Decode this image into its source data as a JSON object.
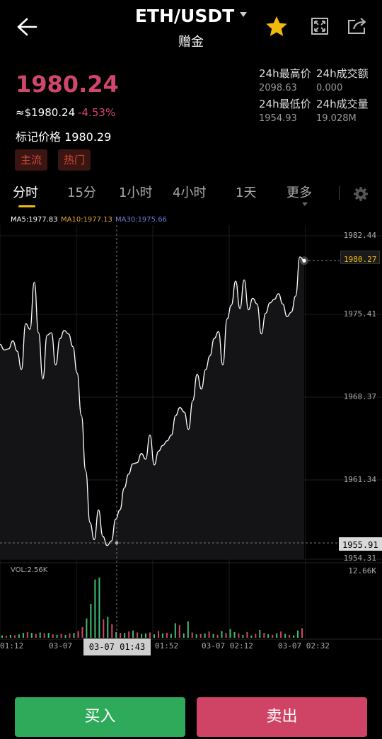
{
  "header": {
    "title": "ETH/USDT",
    "subtitle": "赠金",
    "back_icon": "arrow-left-icon",
    "favorite_icon": "star-icon",
    "fullscreen_icon": "fullscreen-icon",
    "share_icon": "share-icon",
    "accent_star": "#f0b90b"
  },
  "price": {
    "last": "1980.24",
    "usd": "≈$1980.24",
    "change": "-4.53%",
    "mark_label": "标记价格",
    "mark_value": "1980.29",
    "tags": [
      "主流",
      "热门"
    ],
    "color_down": "#d0466c"
  },
  "stats": {
    "high_label": "24h最高价",
    "high_value": "2098.63",
    "turnover_label": "24h成交额",
    "turnover_value": "0.000",
    "low_label": "24h最低价",
    "low_value": "1954.93",
    "volume_label": "24h成交量",
    "volume_value": "19.028M"
  },
  "timeframes": {
    "items": [
      "分时",
      "15分",
      "1小时",
      "4小时",
      "1天",
      "更多"
    ],
    "active": "分时",
    "settings_icon": "gear-icon"
  },
  "ma": {
    "ma5": "MA5:1977.83",
    "ma10": "MA10:1977.13",
    "ma30": "MA30:1975.66",
    "ma5_color": "#ffffff",
    "ma10_color": "#e8a23c",
    "ma30_color": "#6f7fd8"
  },
  "chart_data": {
    "type": "line",
    "y_ticks": [
      "1982.44",
      "1975.41",
      "1968.37",
      "1961.34",
      "1954.31"
    ],
    "ylim": [
      1954.31,
      1982.44
    ],
    "current_price_label": "1980.27",
    "crosshair_price_label": "1955.91",
    "crosshair_time_label": "03-07 01:43",
    "x_tick_labels": [
      "01:12",
      "03-07",
      "01:52",
      "03-07 02:12",
      "03-07 02:32"
    ],
    "values": [
      1973.0,
      1972.5,
      1972.6,
      1973.3,
      1972.4,
      1970.8,
      1974.8,
      1974.3,
      1978.4,
      1974.0,
      1970.0,
      1973.8,
      1974.0,
      1971.2,
      1973.5,
      1974.2,
      1973.9,
      1972.8,
      1970.5,
      1966.8,
      1962.0,
      1957.5,
      1956.0,
      1958.6,
      1956.3,
      1955.5,
      1955.9,
      1957.8,
      1958.6,
      1960.5,
      1961.7,
      1962.6,
      1962.7,
      1963.5,
      1963.0,
      1965.1,
      1962.5,
      1963.7,
      1964.2,
      1964.6,
      1965.1,
      1966.8,
      1967.5,
      1967.1,
      1965.6,
      1968.1,
      1970.4,
      1969.1,
      1970.8,
      1972.0,
      1973.5,
      1974.1,
      1971.2,
      1975.2,
      1976.4,
      1978.5,
      1976.1,
      1978.6,
      1976.0,
      1977.0,
      1976.5,
      1973.9,
      1975.7,
      1976.6,
      1976.9,
      1977.4,
      1976.5,
      1975.4,
      1975.8,
      1977.2,
      1980.6,
      1980.27
    ],
    "vol_label": "VOL:2.56K",
    "vol_max_label": "12.66K",
    "volumes": [
      0.5,
      0.4,
      0.6,
      0.5,
      0.7,
      1.0,
      1.2,
      1.0,
      0.8,
      1.1,
      0.9,
      1.0,
      0.7,
      0.6,
      0.8,
      0.6,
      0.9,
      1.0,
      1.4,
      2.2,
      4.0,
      7.0,
      12.0,
      12.4,
      3.8,
      4.3,
      2.8,
      1.2,
      1.0,
      1.0,
      1.3,
      1.5,
      1.1,
      0.8,
      0.9,
      1.1,
      0.7,
      1.4,
      0.9,
      1.0,
      0.8,
      3.0,
      2.6,
      0.9,
      3.4,
      1.1,
      0.7,
      0.8,
      0.9,
      1.3,
      0.8,
      0.6,
      1.4,
      1.0,
      1.8,
      1.2,
      0.9,
      0.6,
      1.2,
      0.5,
      0.8,
      1.6,
      1.0,
      0.7,
      0.6,
      0.9,
      1.3,
      0.8,
      0.6,
      0.5,
      1.5,
      2.0
    ],
    "volume_up": [
      true,
      false,
      true,
      false,
      true,
      true,
      false,
      true,
      false,
      true,
      false,
      true,
      false,
      true,
      false,
      true,
      false,
      true,
      false,
      false,
      true,
      true,
      true,
      true,
      false,
      true,
      false,
      true,
      false,
      true,
      false,
      true,
      false,
      true,
      true,
      false,
      true,
      false,
      true,
      false,
      true,
      true,
      false,
      true,
      true,
      false,
      true,
      false,
      true,
      false,
      true,
      false,
      true,
      false,
      true,
      true,
      false,
      true,
      false,
      true,
      false,
      true,
      false,
      true,
      false,
      true,
      false,
      true,
      false,
      true,
      true,
      false
    ],
    "line_color": "#ffffff",
    "up_color": "#3fbf6f",
    "down_color": "#d0466c"
  },
  "actions": {
    "buy_label": "买入",
    "sell_label": "卖出",
    "buy_color": "#2faa5b",
    "sell_color": "#cf4464"
  }
}
